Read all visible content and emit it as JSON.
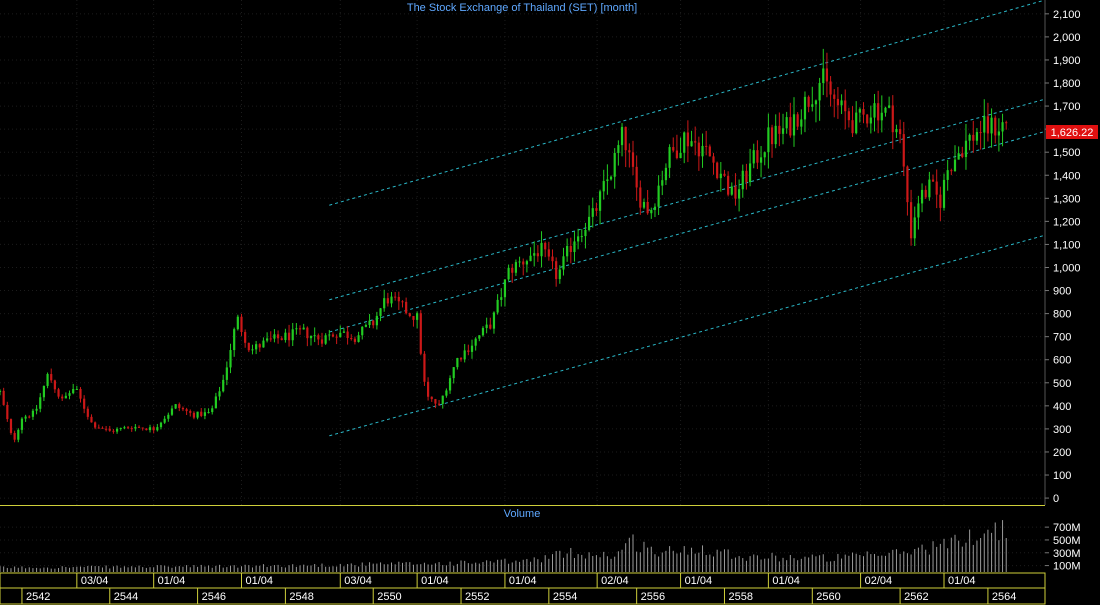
{
  "chart_data": {
    "type": "candlestick",
    "title": "The Stock Exchange of Thailand (SET) [month]",
    "price_axis": {
      "ticks": [
        0,
        100,
        200,
        300,
        400,
        500,
        600,
        700,
        800,
        900,
        1000,
        1100,
        1200,
        1300,
        1400,
        1500,
        1600,
        1700,
        1800,
        1900,
        2000,
        2100
      ],
      "tick_labels": [
        "0",
        "100",
        "200",
        "300",
        "400",
        "500",
        "600",
        "700",
        "800",
        "900",
        "1,000",
        "1,100",
        "1,200",
        "1,300",
        "1,400",
        "1,500",
        "1,600",
        "1,700",
        "1,800",
        "1,900",
        "2,000",
        "2,100"
      ],
      "ylim": [
        -30,
        2160
      ]
    },
    "last_price": {
      "value": 1626.22,
      "label": "1,626.22"
    },
    "volume_panel": {
      "title": "Volume",
      "ticks": [
        100,
        300,
        500,
        700
      ],
      "tick_labels": [
        "100M",
        "300M",
        "500M",
        "700M"
      ],
      "ylim": [
        0,
        780
      ]
    },
    "x_axis": {
      "start_year": 2541.5,
      "end_year": 2565.3,
      "date_ticks": [
        {
          "year": 2543.25,
          "label": "03/04"
        },
        {
          "year": 2545.0,
          "label": "01/04"
        },
        {
          "year": 2547.0,
          "label": "01/04"
        },
        {
          "year": 2549.25,
          "label": "03/04"
        },
        {
          "year": 2551.0,
          "label": "01/04"
        },
        {
          "year": 2553.0,
          "label": "01/04"
        },
        {
          "year": 2555.1,
          "label": "02/04"
        },
        {
          "year": 2557.0,
          "label": "01/04"
        },
        {
          "year": 2559.0,
          "label": "01/04"
        },
        {
          "year": 2561.1,
          "label": "02/04"
        },
        {
          "year": 2563.0,
          "label": "01/04"
        }
      ],
      "year_ticks": [
        "2542",
        "2544",
        "2546",
        "2548",
        "2550",
        "2552",
        "2554",
        "2556",
        "2558",
        "2560",
        "2562",
        "2564"
      ]
    },
    "price_path": [
      [
        2541.5,
        460
      ],
      [
        2541.8,
        240
      ],
      [
        2542.0,
        350
      ],
      [
        2542.3,
        370
      ],
      [
        2542.6,
        540
      ],
      [
        2542.9,
        420
      ],
      [
        2543.2,
        480
      ],
      [
        2543.6,
        320
      ],
      [
        2544.0,
        290
      ],
      [
        2544.5,
        310
      ],
      [
        2545.0,
        300
      ],
      [
        2545.5,
        400
      ],
      [
        2545.9,
        360
      ],
      [
        2546.3,
        370
      ],
      [
        2546.6,
        520
      ],
      [
        2546.9,
        780
      ],
      [
        2547.2,
        640
      ],
      [
        2547.6,
        680
      ],
      [
        2548.0,
        700
      ],
      [
        2548.4,
        720
      ],
      [
        2548.8,
        690
      ],
      [
        2549.2,
        720
      ],
      [
        2549.6,
        700
      ],
      [
        2550.0,
        760
      ],
      [
        2550.3,
        870
      ],
      [
        2550.7,
        820
      ],
      [
        2551.0,
        780
      ],
      [
        2551.2,
        440
      ],
      [
        2551.5,
        400
      ],
      [
        2551.9,
        600
      ],
      [
        2552.3,
        680
      ],
      [
        2552.7,
        760
      ],
      [
        2553.1,
        990
      ],
      [
        2553.5,
        1040
      ],
      [
        2553.8,
        1080
      ],
      [
        2554.2,
        960
      ],
      [
        2554.6,
        1140
      ],
      [
        2555.0,
        1220
      ],
      [
        2555.4,
        1410
      ],
      [
        2555.7,
        1580
      ],
      [
        2556.0,
        1330
      ],
      [
        2556.3,
        1240
      ],
      [
        2556.7,
        1470
      ],
      [
        2557.1,
        1570
      ],
      [
        2557.5,
        1520
      ],
      [
        2557.9,
        1420
      ],
      [
        2558.2,
        1300
      ],
      [
        2558.6,
        1440
      ],
      [
        2559.0,
        1560
      ],
      [
        2559.4,
        1600
      ],
      [
        2559.8,
        1700
      ],
      [
        2560.2,
        1820
      ],
      [
        2560.6,
        1690
      ],
      [
        2561.0,
        1620
      ],
      [
        2561.4,
        1700
      ],
      [
        2561.8,
        1660
      ],
      [
        2562.0,
        1560
      ],
      [
        2562.25,
        1150
      ],
      [
        2562.4,
        1290
      ],
      [
        2562.7,
        1350
      ],
      [
        2562.9,
        1280
      ],
      [
        2563.1,
        1440
      ],
      [
        2563.4,
        1520
      ],
      [
        2563.8,
        1600
      ],
      [
        2564.2,
        1610
      ],
      [
        2564.45,
        1626
      ]
    ],
    "trend_lines": [
      {
        "x1": 2549.0,
        "y1": 270,
        "x2": 2565.3,
        "y2": 1140
      },
      {
        "x1": 2549.0,
        "y1": 720,
        "x2": 2565.3,
        "y2": 1590
      },
      {
        "x1": 2549.0,
        "y1": 860,
        "x2": 2565.3,
        "y2": 1730
      },
      {
        "x1": 2549.0,
        "y1": 1270,
        "x2": 2565.3,
        "y2": 2160
      }
    ],
    "volume_path": [
      [
        2541.5,
        70
      ],
      [
        2547.0,
        90
      ],
      [
        2550.0,
        120
      ],
      [
        2552.0,
        140
      ],
      [
        2553.5,
        170
      ],
      [
        2554.5,
        300
      ],
      [
        2555.5,
        260
      ],
      [
        2555.9,
        480
      ],
      [
        2556.5,
        300
      ],
      [
        2557.5,
        380
      ],
      [
        2558.5,
        240
      ],
      [
        2559.5,
        230
      ],
      [
        2560.5,
        220
      ],
      [
        2561.5,
        260
      ],
      [
        2562.0,
        300
      ],
      [
        2562.6,
        380
      ],
      [
        2563.2,
        450
      ],
      [
        2563.8,
        600
      ],
      [
        2564.2,
        690
      ],
      [
        2564.45,
        640
      ]
    ]
  }
}
